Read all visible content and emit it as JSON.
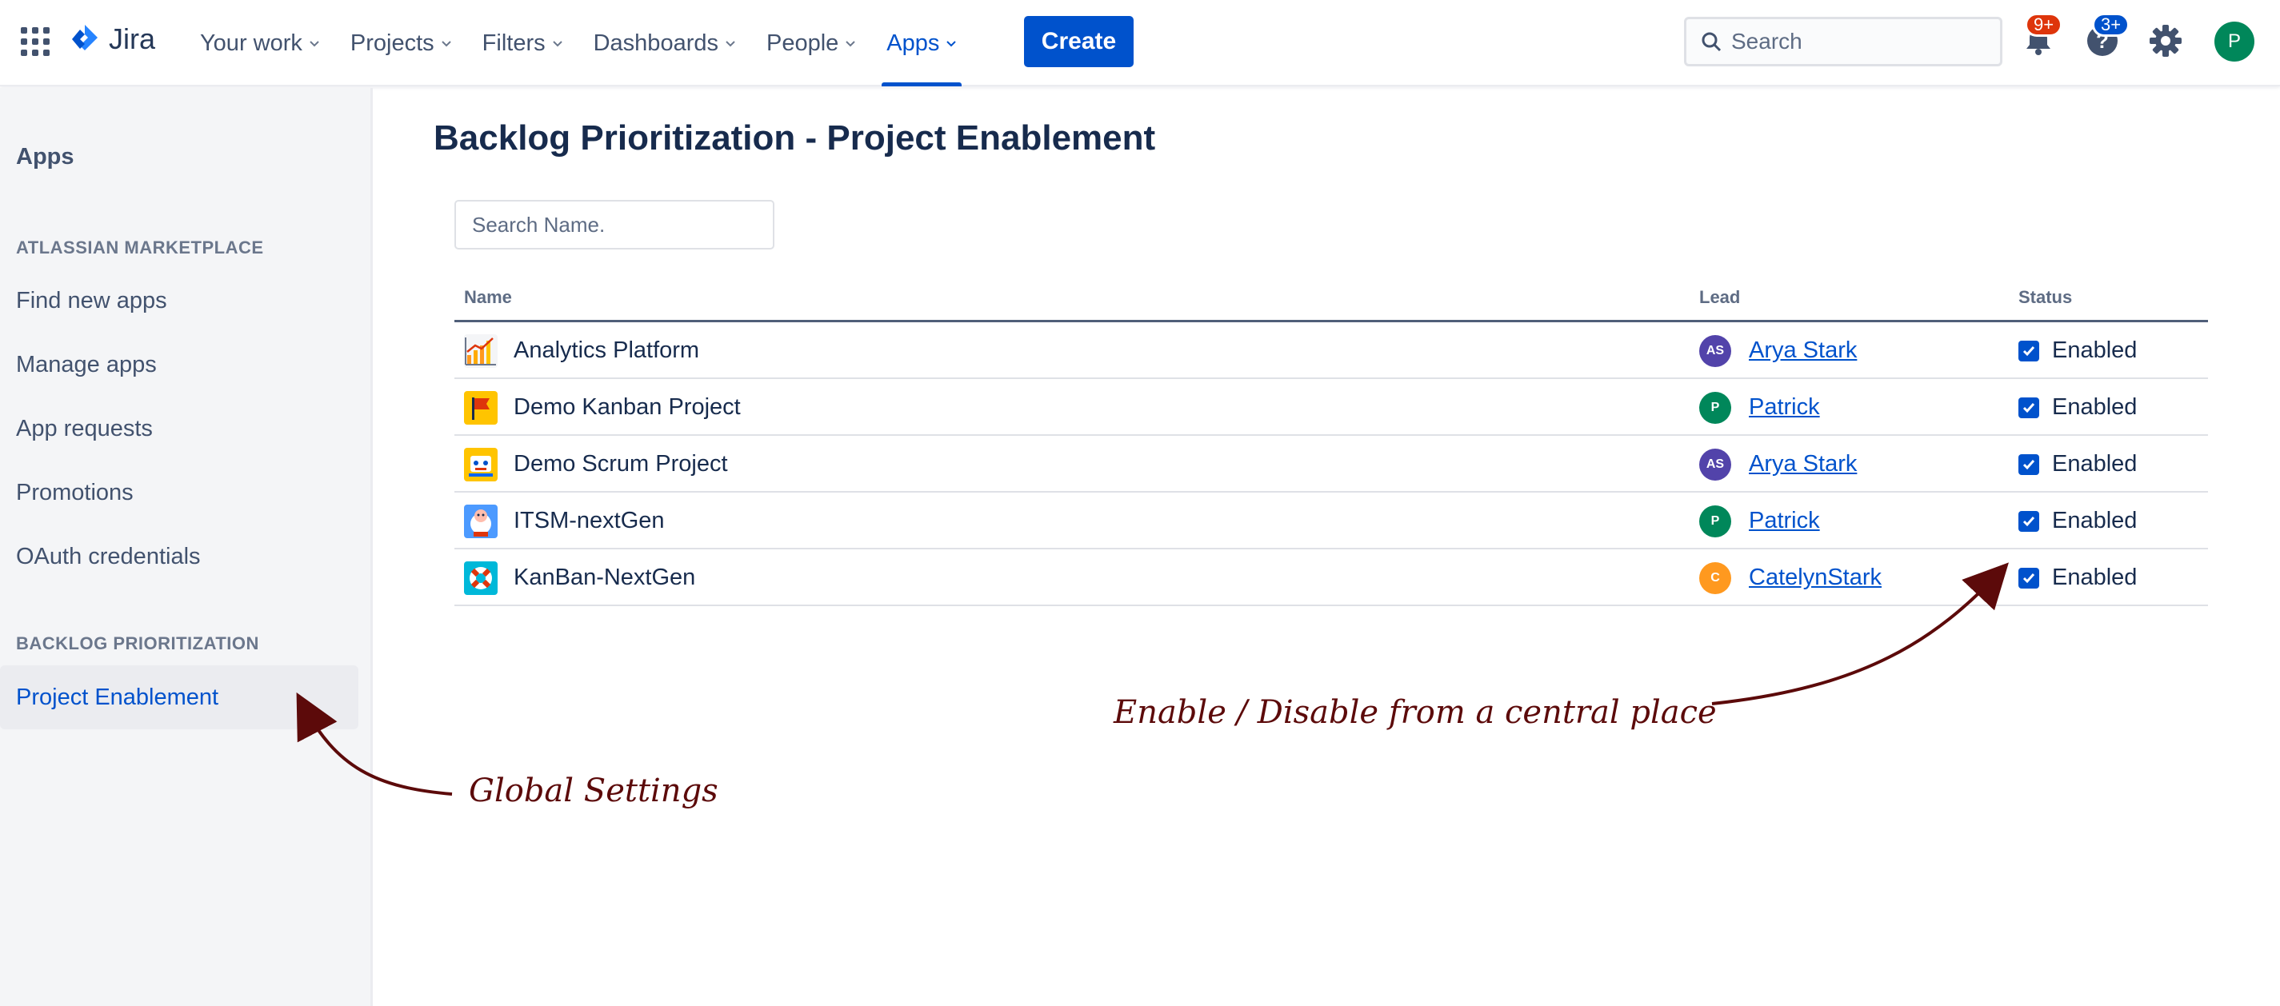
{
  "topnav": {
    "logo_text": "Jira",
    "items": [
      {
        "label": "Your work",
        "active": false
      },
      {
        "label": "Projects",
        "active": false
      },
      {
        "label": "Filters",
        "active": false
      },
      {
        "label": "Dashboards",
        "active": false
      },
      {
        "label": "People",
        "active": false
      },
      {
        "label": "Apps",
        "active": true
      }
    ],
    "create_label": "Create",
    "search_placeholder": "Search",
    "notifications_badge": "9+",
    "help_badge": "3+",
    "user_initial": "P",
    "accent_color": "#0052CC"
  },
  "sidebar": {
    "title": "Apps",
    "sections": [
      {
        "heading": "ATLASSIAN MARKETPLACE",
        "items": [
          "Find new apps",
          "Manage apps",
          "App requests",
          "Promotions",
          "OAuth credentials"
        ]
      },
      {
        "heading": "BACKLOG PRIORITIZATION",
        "items": [
          "Project Enablement"
        ]
      }
    ],
    "selected_item": "Project Enablement"
  },
  "main": {
    "title": "Backlog Prioritization - Project Enablement",
    "search_placeholder": "Search Name.",
    "columns": [
      "Name",
      "Lead",
      "Status"
    ],
    "rows": [
      {
        "name": "Analytics Platform",
        "icon": "chart-icon",
        "lead": "Arya Stark",
        "lead_initials": "AS",
        "lead_color": "#5243AA",
        "status": "Enabled",
        "checked": true
      },
      {
        "name": "Demo Kanban Project",
        "icon": "flag-icon",
        "lead": "Patrick",
        "lead_initials": "P",
        "lead_color": "#00875A",
        "status": "Enabled",
        "checked": true
      },
      {
        "name": "Demo Scrum Project",
        "icon": "robot-icon",
        "lead": "Arya Stark",
        "lead_initials": "AS",
        "lead_color": "#5243AA",
        "status": "Enabled",
        "checked": true
      },
      {
        "name": "ITSM-nextGen",
        "icon": "sheep-icon",
        "lead": "Patrick",
        "lead_initials": "P",
        "lead_color": "#00875A",
        "status": "Enabled",
        "checked": true
      },
      {
        "name": "KanBan-NextGen",
        "icon": "lifebuoy-icon",
        "lead": "CatelynStark",
        "lead_initials": "C",
        "lead_color": "#FF991F",
        "status": "Enabled",
        "checked": true
      }
    ]
  },
  "annotations": {
    "global": "Global Settings",
    "central": "Enable / Disable from a central place",
    "color": "#5C0A0A"
  }
}
